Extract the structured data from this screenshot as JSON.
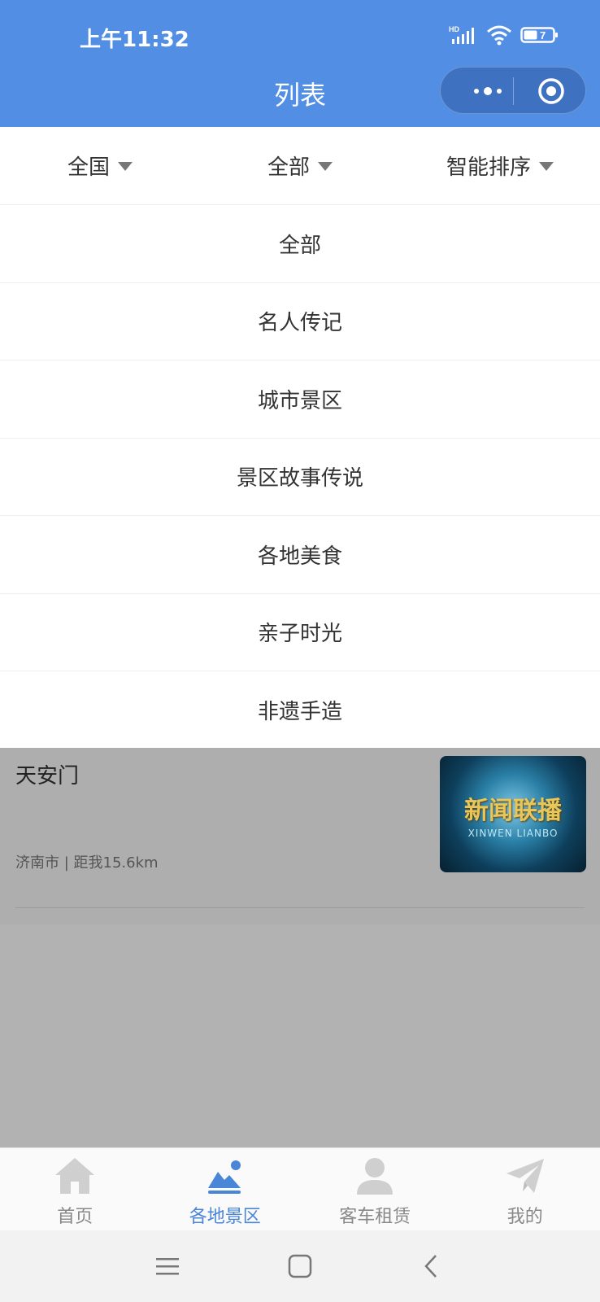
{
  "status_bar": {
    "time": "上午11:32",
    "signal_label": "HD",
    "battery": "7"
  },
  "nav": {
    "title": "列表"
  },
  "filters": [
    {
      "label": "全国"
    },
    {
      "label": "全部"
    },
    {
      "label": "智能排序"
    }
  ],
  "dropdown": {
    "options": [
      "全部",
      "名人传记",
      "城市景区",
      "景区故事传说",
      "各地美食",
      "亲子时光",
      "非遗手造"
    ]
  },
  "list": {
    "items": [
      {
        "title": "天安门",
        "meta": "济南市 | 距我15.6km",
        "thumb_title": "新闻联播",
        "thumb_subtitle": "XINWEN LIANBO"
      }
    ]
  },
  "tabbar": {
    "tabs": [
      {
        "label": "首页",
        "icon": "home-icon"
      },
      {
        "label": "各地景区",
        "icon": "scenery-icon",
        "active": true
      },
      {
        "label": "客车租赁",
        "icon": "person-icon"
      },
      {
        "label": "我的",
        "icon": "paper-plane-icon"
      }
    ]
  },
  "colors": {
    "primary": "#518ee4",
    "active_tab": "#4a86d8",
    "overlay": "#b2b2b2"
  }
}
